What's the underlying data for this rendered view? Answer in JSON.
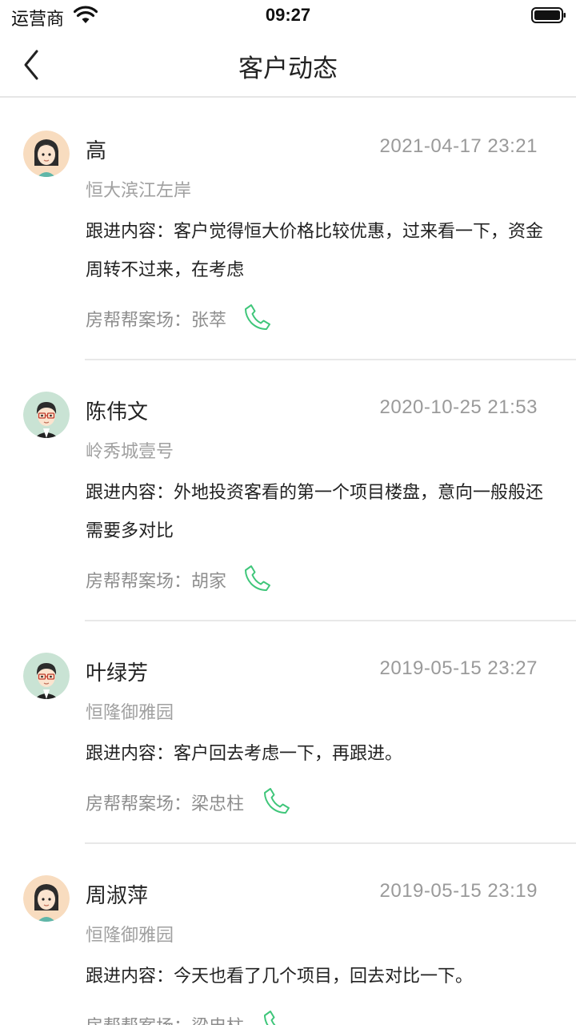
{
  "status_bar": {
    "carrier": "运营商",
    "time": "09:27"
  },
  "nav": {
    "title": "客户动态"
  },
  "colors": {
    "phone_green": "#3fc67a",
    "avatar_female_bg": "#f8dcbf",
    "avatar_male_bg": "#c9e3d4"
  },
  "entries": [
    {
      "name": "高",
      "date": "2021-04-17 23:21",
      "project": "恒大滨江左岸",
      "content_prefix": "跟进内容：",
      "content": "客户觉得恒大价格比较优惠，过来看一下，资金周转不过来，在考虑",
      "agent_prefix": "房帮帮案场：",
      "agent": "张萃",
      "avatar_icon": "female-avatar-icon"
    },
    {
      "name": "陈伟文",
      "date": "2020-10-25 21:53",
      "project": "岭秀城壹号",
      "content_prefix": "跟进内容：",
      "content": "外地投资客看的第一个项目楼盘，意向一般般还需要多对比",
      "agent_prefix": "房帮帮案场：",
      "agent": "胡家",
      "avatar_icon": "male-avatar-icon"
    },
    {
      "name": "叶绿芳",
      "date": "2019-05-15 23:27",
      "project": "恒隆御雅园",
      "content_prefix": "跟进内容：",
      "content": "客户回去考虑一下，再跟进。",
      "agent_prefix": "房帮帮案场：",
      "agent": "梁忠柱",
      "avatar_icon": "male-avatar-icon"
    },
    {
      "name": "周淑萍",
      "date": "2019-05-15 23:19",
      "project": "恒隆御雅园",
      "content_prefix": "跟进内容：",
      "content": "今天也看了几个项目，回去对比一下。",
      "agent_prefix": "房帮帮案场：",
      "agent": "梁忠柱",
      "avatar_icon": "female-avatar-icon"
    }
  ]
}
